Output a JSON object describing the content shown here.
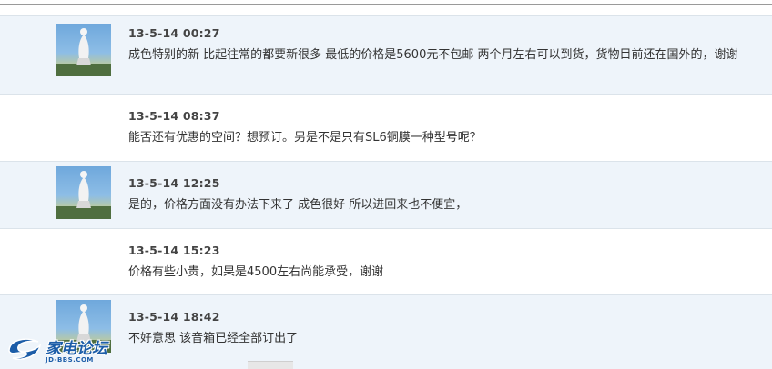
{
  "messages": [
    {
      "time": "13-5-14 00:27",
      "text": "成色特别的新  比起往常的都要新很多  最低的价格是5600元不包邮 两个月左右可以到货，货物目前还在国外的，谢谢",
      "has_avatar": true
    },
    {
      "time": "13-5-14 08:37",
      "text": "能否还有优惠的空间？想预订。另是不是只有SL6铜膜一种型号呢？",
      "has_avatar": false
    },
    {
      "time": "13-5-14 12:25",
      "text": "是的，价格方面没有办法下来了  成色很好 所以进回来也不便宜，",
      "has_avatar": true
    },
    {
      "time": "13-5-14 15:23",
      "text": "价格有些小贵，如果是4500左右尚能承受，谢谢",
      "has_avatar": false
    },
    {
      "time": "13-5-14 18:42",
      "text": "不好意思  该音箱已经全部订出了",
      "has_avatar": true
    }
  ],
  "watermark": {
    "title": "家电论坛",
    "subtitle": "JD-BBS.COM"
  },
  "colors": {
    "row_blue": "#eef4fa",
    "row_white": "#ffffff",
    "border": "#dbe3ea",
    "brand": "#1c5da8"
  }
}
